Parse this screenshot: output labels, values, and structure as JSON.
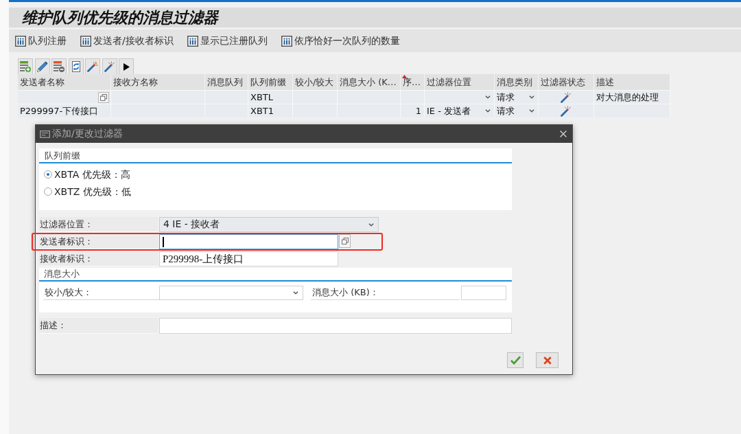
{
  "title": "维护队列优先级的消息过滤器",
  "menu": [
    "队列注册",
    "发送者/接收者标识",
    "显示已注册队列",
    "依序恰好一次队列的数量"
  ],
  "table": {
    "columns": [
      {
        "label": "发送者名称",
        "sorted": false
      },
      {
        "label": "接收方名称",
        "sorted": false
      },
      {
        "label": "消息队列",
        "sorted": false
      },
      {
        "label": "队列前缀",
        "sorted": false
      },
      {
        "label": "较小/较大",
        "sorted": false
      },
      {
        "label": "消息大小 (K…",
        "sorted": false
      },
      {
        "label": "序…",
        "sorted": true
      },
      {
        "label": "过滤器位置",
        "sorted": false
      },
      {
        "label": "消息类别",
        "sorted": false
      },
      {
        "label": "过滤器状态",
        "sorted": false
      },
      {
        "label": "描述",
        "sorted": false
      }
    ],
    "rows": [
      {
        "cells": [
          {
            "kind": "help"
          },
          {
            "kind": "text"
          },
          {
            "kind": "text"
          },
          {
            "kind": "text",
            "text": "XBTL"
          },
          {
            "kind": "text"
          },
          {
            "kind": "text"
          },
          {
            "kind": "number"
          },
          {
            "kind": "select"
          },
          {
            "kind": "select",
            "text": "请求"
          },
          {
            "kind": "status"
          },
          {
            "kind": "text",
            "text": "对大消息的处理"
          }
        ]
      },
      {
        "cells": [
          {
            "kind": "text",
            "text": "P299997-下传接口"
          },
          {
            "kind": "text"
          },
          {
            "kind": "text"
          },
          {
            "kind": "text",
            "text": "XBT1"
          },
          {
            "kind": "text"
          },
          {
            "kind": "text"
          },
          {
            "kind": "number",
            "text": "1"
          },
          {
            "kind": "select",
            "text": "IE - 发送者"
          },
          {
            "kind": "select",
            "text": "请求"
          },
          {
            "kind": "status"
          },
          {
            "kind": "text"
          }
        ]
      }
    ]
  },
  "dialog": {
    "title": "添加/更改过滤器",
    "prefix_group": {
      "title": "队列前缀",
      "options": [
        {
          "label": "XBTA 优先级：高",
          "selected": true
        },
        {
          "label": "XBTZ 优先级：低",
          "selected": false
        }
      ]
    },
    "fields": [
      {
        "label": "过滤器位置：",
        "kind": "select",
        "value": "4 IE - 接收者",
        "focused": false,
        "value_help": false,
        "highlighted": false
      },
      {
        "label": "发送者标识：",
        "kind": "input",
        "focused": true,
        "value_help": true,
        "highlighted": true
      },
      {
        "label": "接收者标识：",
        "kind": "input",
        "value": "P299998-上传接口",
        "focused": false,
        "value_help": false,
        "highlighted": false
      }
    ],
    "size_group": {
      "title": "消息大小",
      "fields": [
        {
          "label": "较小/较大：",
          "kind": "select"
        },
        {
          "label": "消息大小 (KB)：",
          "kind": "input"
        }
      ]
    },
    "description": {
      "label": "描述：",
      "kind": "input"
    },
    "buttons": [
      {
        "kind": "confirm"
      },
      {
        "kind": "cancel"
      }
    ]
  }
}
